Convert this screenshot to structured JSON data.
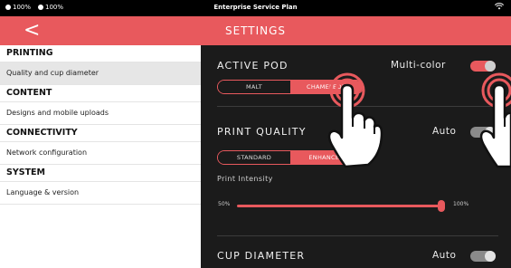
{
  "status_bar": {
    "battery_1": "100%",
    "battery_2": "100%",
    "plan": "Enterprise Service Plan",
    "wifi_icon": "wifi-icon"
  },
  "header": {
    "back_icon": "chevron-left-icon",
    "back_glyph": "<",
    "title": "SETTINGS"
  },
  "sidebar": {
    "sections": [
      {
        "title": "PRINTING",
        "item": "Quality and cup diameter",
        "active": true
      },
      {
        "title": "CONTENT",
        "item": "Designs and mobile uploads",
        "active": false
      },
      {
        "title": "CONNECTIVITY",
        "item": "Network configuration",
        "active": false
      },
      {
        "title": "SYSTEM",
        "item": "Language & version",
        "active": false
      }
    ]
  },
  "main": {
    "active_pod": {
      "title": "ACTIVE POD",
      "toggle_label": "Multi-color",
      "toggle_on": true,
      "options": [
        "MALT",
        "CHAMELEON"
      ],
      "selected": "CHAMELEON"
    },
    "print_quality": {
      "title": "PRINT QUALITY",
      "toggle_label": "Auto",
      "toggle_on": false,
      "options": [
        "STANDARD",
        "ENHANCED"
      ],
      "selected": "ENHANCED",
      "intensity_label": "Print Intensity",
      "slider_min": "50%",
      "slider_max": "100%",
      "slider_value_pct": 100
    },
    "cup_diameter": {
      "title": "CUP DIAMETER",
      "toggle_label": "Auto",
      "toggle_on": false
    }
  },
  "colors": {
    "accent": "#e8595d",
    "main_bg": "#1b1b1b",
    "sidebar_bg": "#ffffff"
  },
  "annotation_icons": [
    "pointing-hand-icon",
    "pointing-hand-icon"
  ]
}
